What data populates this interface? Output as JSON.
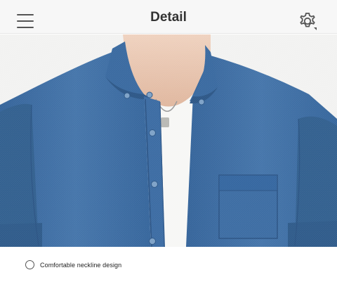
{
  "header": {
    "title": "Detail",
    "menu_icon": "hamburger-menu-icon",
    "settings_icon": "gear-icon"
  },
  "product_image": {
    "subject": "denim short-sleeve shirt",
    "colors": {
      "denim": "#3f6ea3",
      "denim_dark": "#2f5a8c",
      "tee": "#f7f7f5",
      "skin": "#e9c6b0",
      "background": "#f2f2f1"
    }
  },
  "features": [
    {
      "label": "Comfortable neckline design",
      "selected": false
    }
  ]
}
